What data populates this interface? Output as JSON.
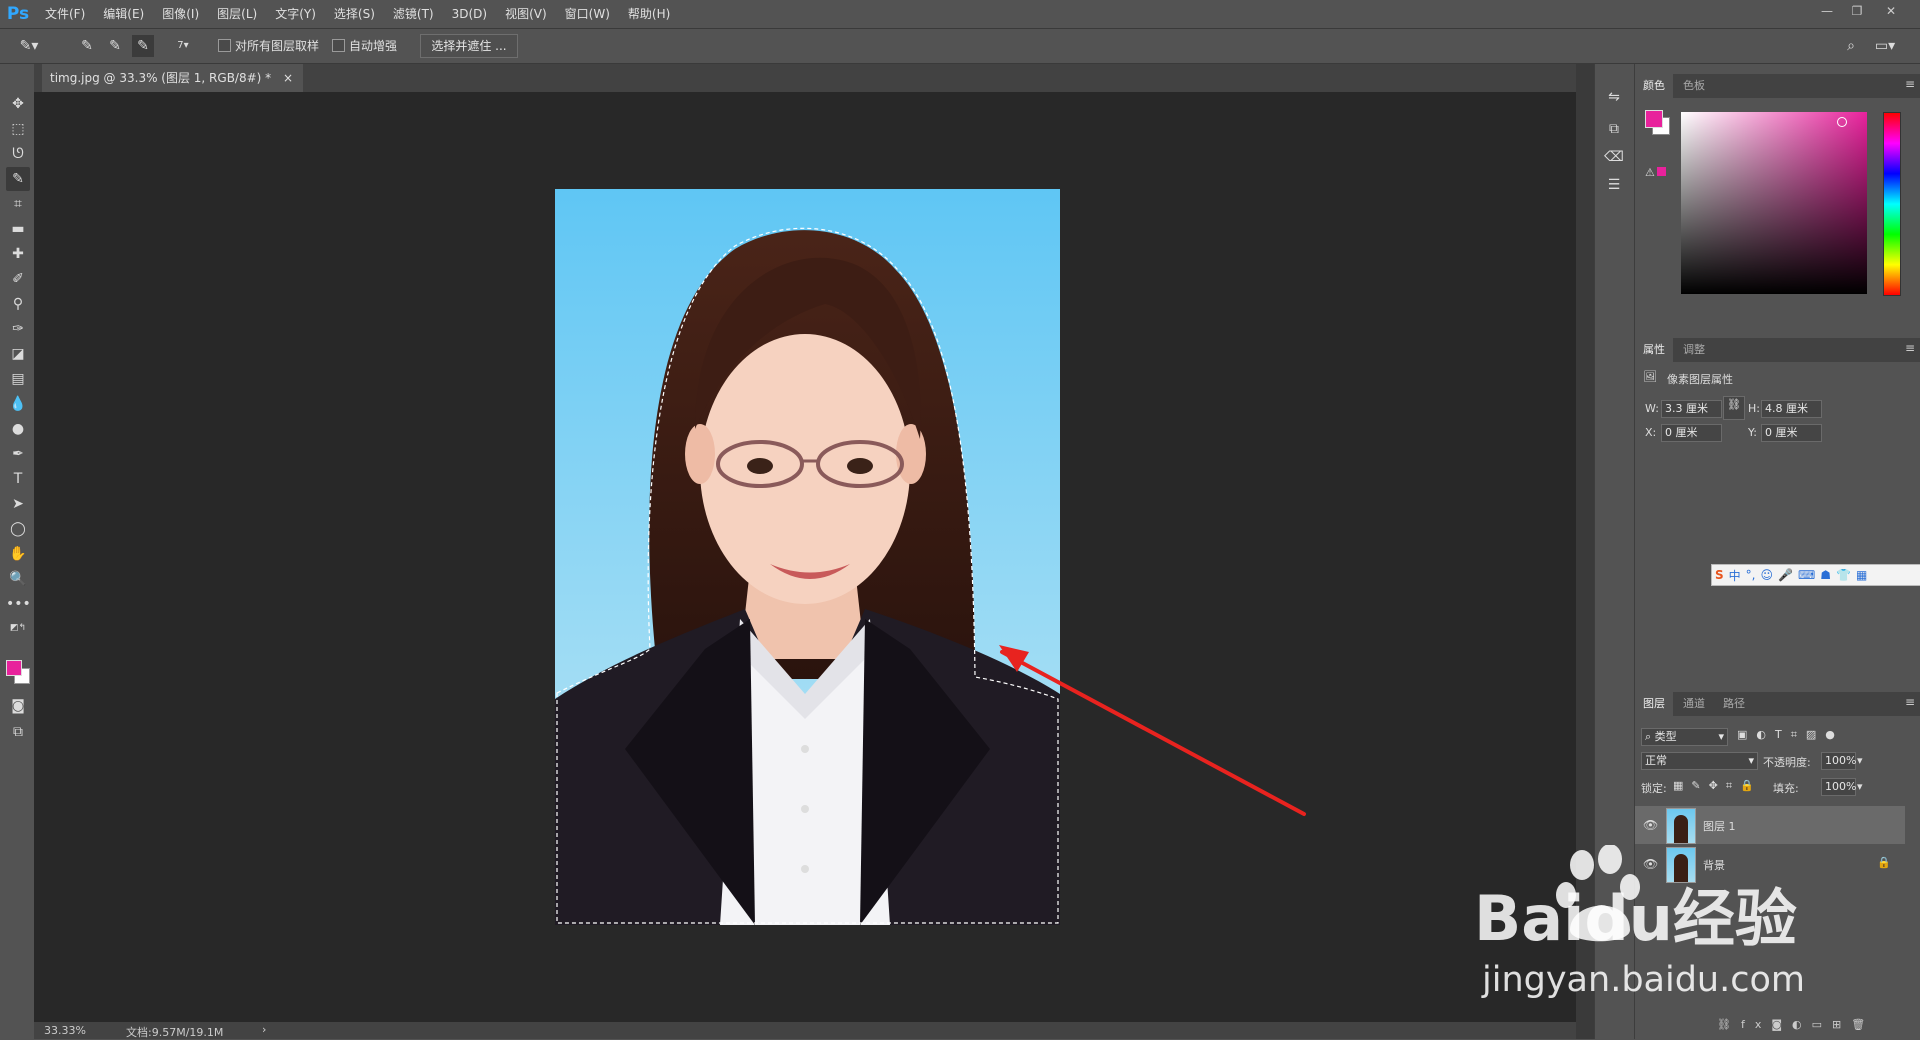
{
  "app": {
    "logo": "Ps"
  },
  "menu": [
    "文件(F)",
    "编辑(E)",
    "图像(I)",
    "图层(L)",
    "文字(Y)",
    "选择(S)",
    "滤镜(T)",
    "3D(D)",
    "视图(V)",
    "窗口(W)",
    "帮助(H)"
  ],
  "options": {
    "brush_size": "7",
    "sample_all_layers": "对所有图层取样",
    "auto_enhance": "自动增强",
    "select_and_mask": "选择并遮住 ..."
  },
  "document_tab": {
    "title": "timg.jpg @ 33.3% (图层 1, RGB/8#) *",
    "close": "×"
  },
  "status": {
    "zoom": "33.33%",
    "doc_size": "文档:9.57M/19.1M",
    "arrow": "›"
  },
  "color_panel": {
    "tabs": [
      "颜色",
      "色板"
    ],
    "foreground": "#e8229c",
    "background": "#ffffff"
  },
  "properties_panel": {
    "tabs": [
      "属性",
      "调整"
    ],
    "title": "像素图层属性",
    "w_label": "W:",
    "w": "3.3 厘米",
    "h_label": "H:",
    "h": "4.8 厘米",
    "x_label": "X:",
    "x": "0 厘米",
    "y_label": "Y:",
    "y": "0 厘米"
  },
  "ime_bar": {
    "label": "中"
  },
  "layers_panel": {
    "tabs": [
      "图层",
      "通道",
      "路径"
    ],
    "filter": "类型",
    "blend_mode": "正常",
    "opacity_label": "不透明度:",
    "opacity": "100%",
    "lock_label": "锁定:",
    "fill_label": "填充:",
    "fill": "100%",
    "layers": [
      {
        "name": "图层 1",
        "selected": true,
        "locked": false
      },
      {
        "name": "背景",
        "selected": false,
        "locked": true
      }
    ]
  },
  "watermark": {
    "brand": "Baidu经验",
    "url": "jingyan.baidu.com"
  },
  "colors": {
    "accent": "#31a8ff",
    "arrow": "#e8231f",
    "selection_bg": "#6a6a6a"
  }
}
